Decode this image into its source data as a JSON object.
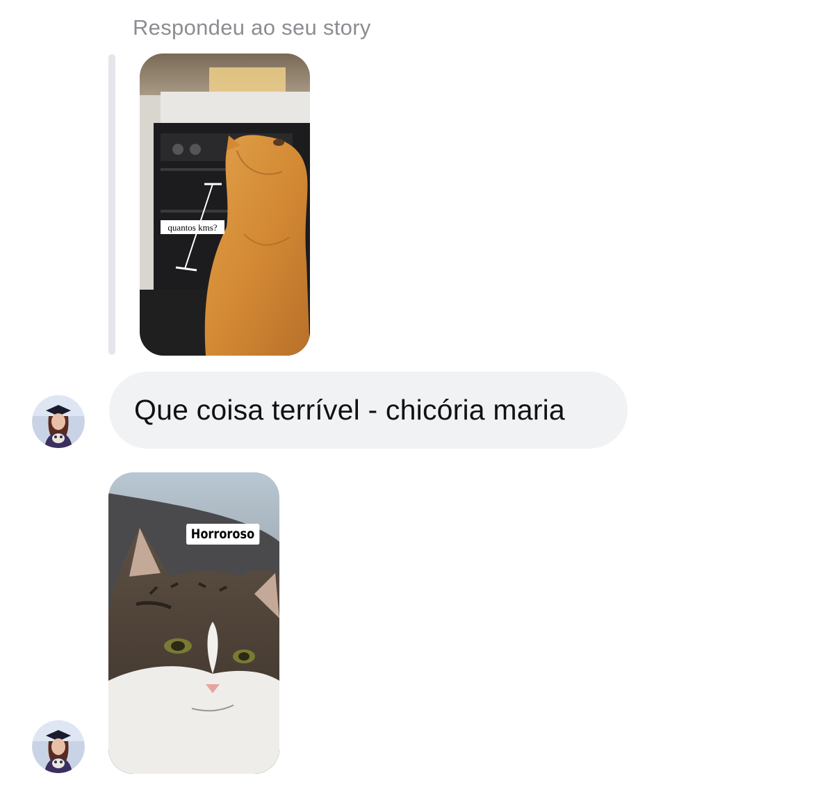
{
  "reply_header": "Respondeu ao seu story",
  "story": {
    "sticker_text": "quantos kms?",
    "image_description_icon": "orange-cat-icon"
  },
  "messages": [
    {
      "type": "text",
      "text": "Que coisa terrível - chicória maria"
    },
    {
      "type": "image",
      "sticker_text": "Horroroso"
    }
  ]
}
